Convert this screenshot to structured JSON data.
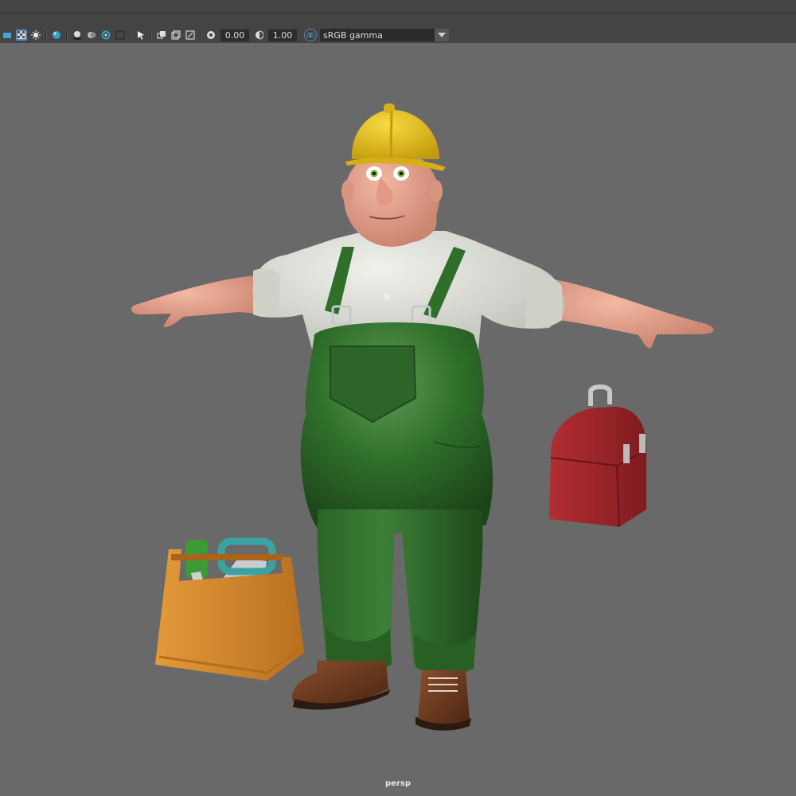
{
  "toolbar": {
    "exposure_value": "0.00",
    "gamma_value": "1.00",
    "color_space": "sRGB gamma",
    "icons": [
      "camera-icon",
      "checker-icon",
      "light-icon",
      "smooth-shade-icon",
      "shadows-icon",
      "ssao-icon",
      "motion-blur-icon",
      "isolate-icon",
      "xray-icon",
      "select-camera-icon",
      "resolution-gate-icon",
      "film-gate-icon",
      "field-chart-icon",
      "exposure-icon",
      "gamma-icon",
      "color-management-icon"
    ]
  },
  "viewport": {
    "camera_label": "persp",
    "background": "#696969"
  },
  "scene": {
    "character": "construction-worker-character",
    "props": [
      "toolbox-with-tools",
      "red-lunchbox"
    ],
    "colors": {
      "helmet": "#e8c21f",
      "shirt": "#d9dbd3",
      "overalls": "#2f6f2a",
      "skin": "#e9a691",
      "boots": "#6b3a1f",
      "toolbox": "#d98a2b",
      "lunchbox": "#a2272b"
    }
  }
}
